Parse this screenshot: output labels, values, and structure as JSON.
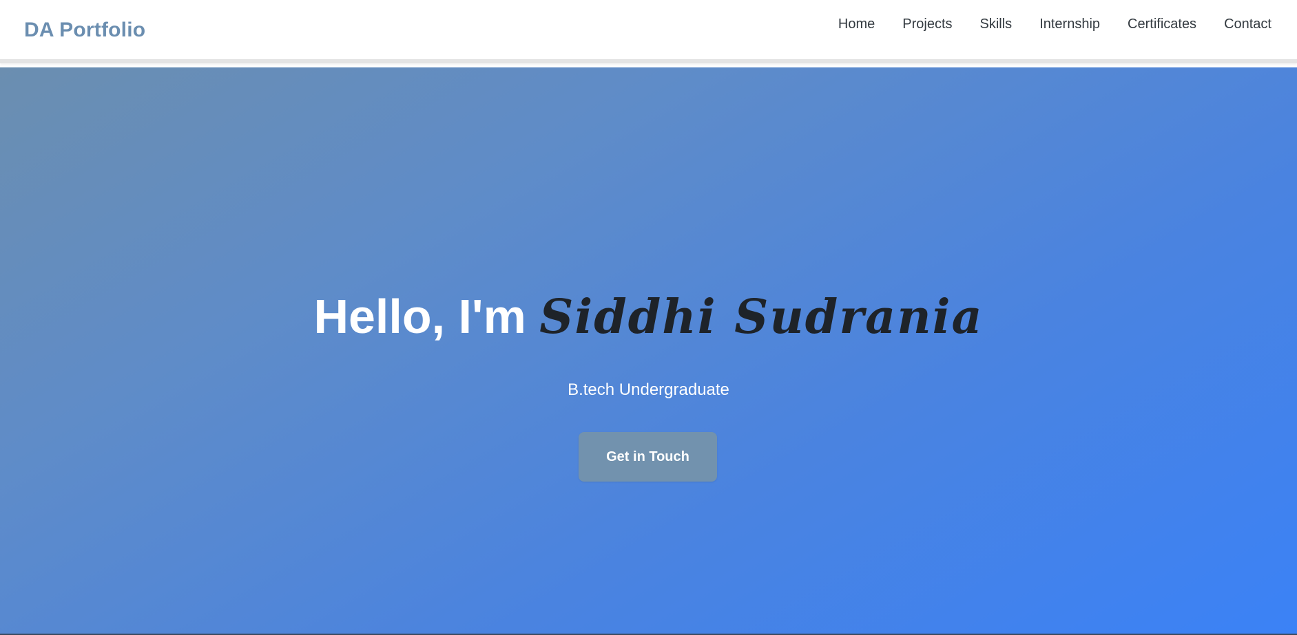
{
  "navbar": {
    "brand": "DA Portfolio",
    "links": [
      "Home",
      "Projects",
      "Skills",
      "Internship",
      "Certificates",
      "Contact"
    ]
  },
  "hero": {
    "greeting": "Hello, I'm",
    "name": "Siddhi Sudrania",
    "subtitle": "B.tech Undergraduate",
    "cta_label": "Get in Touch"
  },
  "colors": {
    "brand": "#6b8eb0",
    "gradient_start": "#6b8eb0",
    "gradient_end": "#3b82f6",
    "button_bg": "#7292ae",
    "name_text": "#1e2329"
  }
}
